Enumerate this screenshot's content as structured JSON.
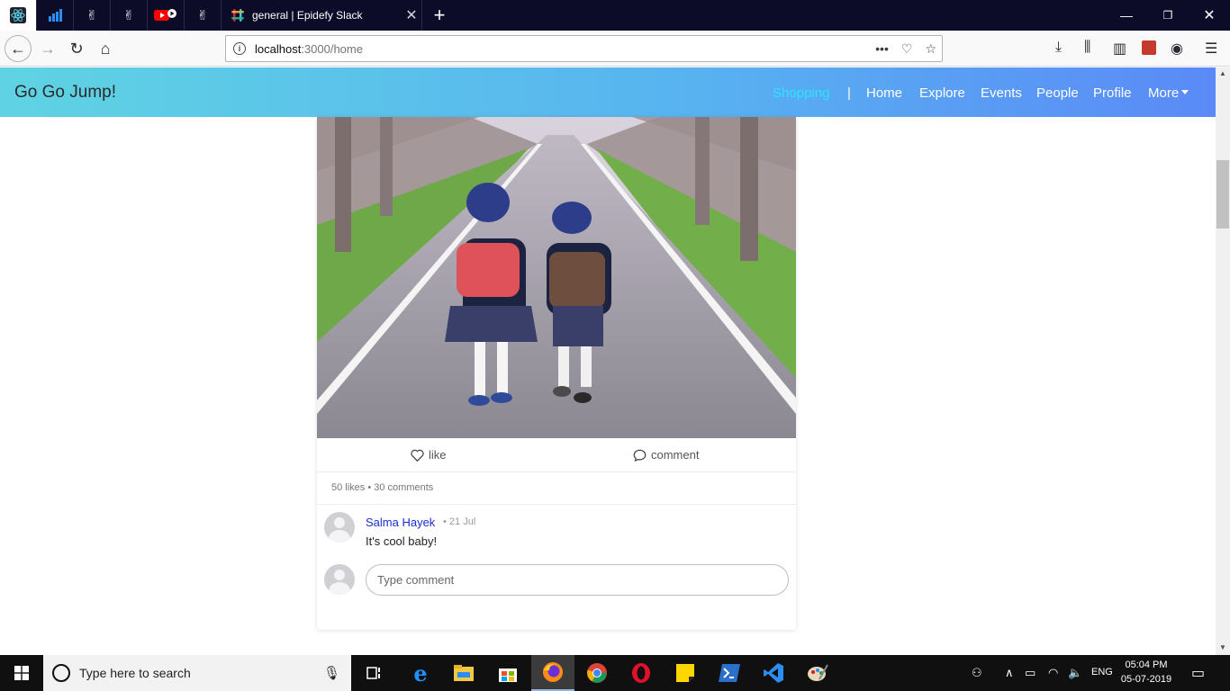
{
  "browser": {
    "tabs": [
      {
        "icon": "react-icon"
      },
      {
        "icon": "bar-chart-icon"
      },
      {
        "icon": "peace-hand-icon"
      },
      {
        "icon": "peace-hand-icon"
      },
      {
        "icon": "youtube-icon"
      },
      {
        "icon": "peace-hand-icon"
      }
    ],
    "active_tab": {
      "title": "general | Epidefy Slack",
      "icon": "slack-icon"
    },
    "url": {
      "host": "localhost",
      "path": ":3000/home"
    }
  },
  "app": {
    "brand": "Go Go Jump!",
    "nav": {
      "shopping": "Shopping",
      "separator": "|",
      "home": "Home",
      "explore": "Explore",
      "events": "Events",
      "people": "People",
      "profile": "Profile",
      "more": "More"
    },
    "colors": {
      "active_nav": "#2de3ff",
      "gradient_start": "#5fd3e3",
      "gradient_end": "#5a8af7"
    }
  },
  "post": {
    "like_label": "like",
    "comment_label": "comment",
    "stats": "50 likes • 30 comments",
    "comments": [
      {
        "author": "Salma Hayek",
        "date": "• 21 Jul",
        "text": "It's cool baby!"
      }
    ],
    "comment_placeholder": "Type comment"
  },
  "taskbar": {
    "search_placeholder": "Type here to search",
    "apps": [
      "task-view-icon",
      "edge-icon",
      "file-explorer-icon",
      "store-icon",
      "firefox-icon",
      "chrome-icon",
      "opera-icon",
      "sticky-notes-icon",
      "powershell-icon",
      "vscode-icon",
      "paint-icon"
    ],
    "lang": "ENG",
    "time": "05:04 PM",
    "date": "05-07-2019"
  }
}
